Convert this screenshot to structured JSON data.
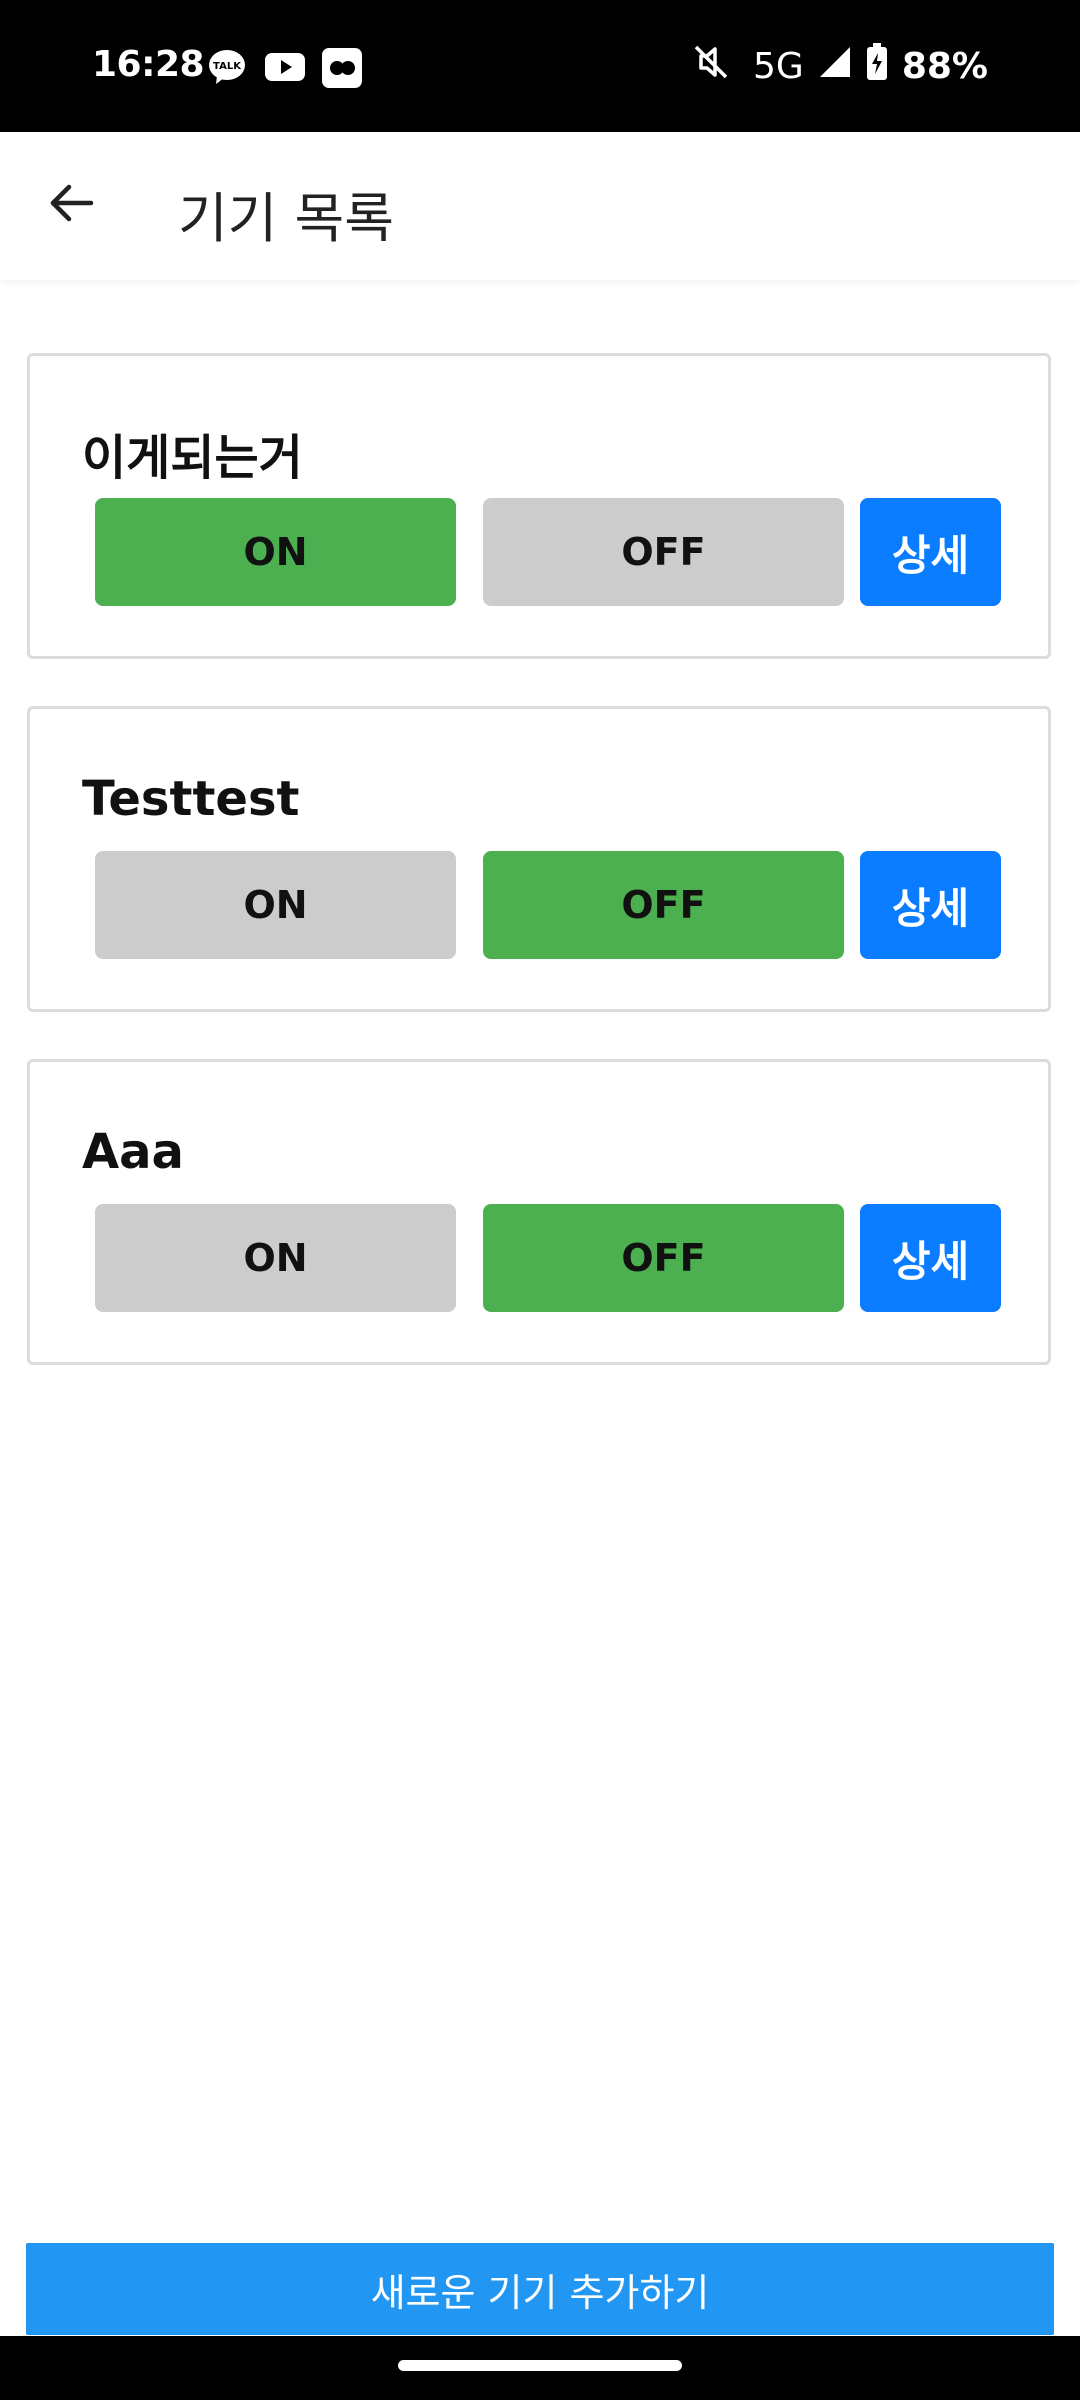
{
  "status_bar": {
    "time": "16:28",
    "notifications": [
      "kakaotalk-icon",
      "youtube-icon",
      "flickr-icon"
    ],
    "network": "5G",
    "battery": "88%",
    "icons": [
      "mute-icon",
      "signal-icon",
      "battery-charging-icon"
    ]
  },
  "app_bar": {
    "back_icon": "arrow-left-icon",
    "title": "기기 목록"
  },
  "devices": [
    {
      "name": "이게되는거",
      "on_label": "ON",
      "off_label": "OFF",
      "detail_label": "상세",
      "state": "on"
    },
    {
      "name": "Testtest",
      "on_label": "ON",
      "off_label": "OFF",
      "detail_label": "상세",
      "state": "off"
    },
    {
      "name": "Aaa",
      "on_label": "ON",
      "off_label": "OFF",
      "detail_label": "상세",
      "state": "off"
    }
  ],
  "add_button": {
    "label": "새로운 기기 추가하기"
  },
  "colors": {
    "active": "#4cb050",
    "inactive": "#cccccc",
    "detail": "#0a7cff",
    "add_button": "#2196f3"
  }
}
